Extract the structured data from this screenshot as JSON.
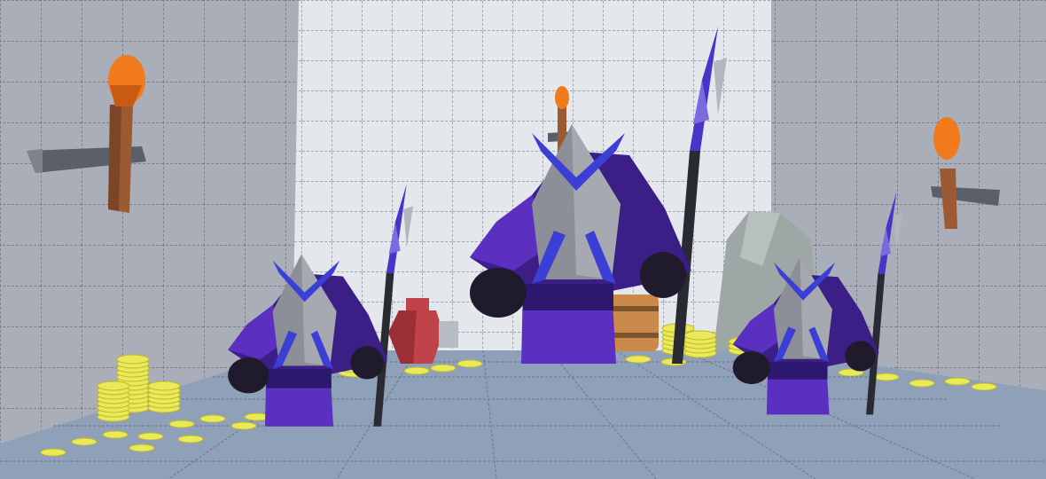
{
  "scene": {
    "colors": {
      "wall_side": "#a7acb6",
      "wall_back": "#e4e7ec",
      "floor": "#8fa0b8",
      "grid_line": "#6f7580",
      "robe": "#5b2fc0",
      "robe_dark": "#3b1f86",
      "hood": "#8c8f97",
      "horn": "#3b3fd6",
      "gauntlet": "#1f1a2c",
      "spear_shaft": "#2a2a33",
      "spear_tip": "#4a34c8",
      "gold": "#e9ea59",
      "gold_edge": "#c4b62c",
      "torch_handle": "#9c5a33",
      "torch_flame": "#f07a1c",
      "barrel": "#c98a4a",
      "vase": "#c0434a",
      "rock": "#9da7a5"
    },
    "enemies": [
      {
        "name": "guard-left"
      },
      {
        "name": "guard-center"
      },
      {
        "name": "guard-right"
      }
    ],
    "props": [
      "wall-torch-left",
      "wall-torch-back",
      "wall-torch-right",
      "treasure-barrel",
      "treasure-vase",
      "cave-rock"
    ]
  }
}
